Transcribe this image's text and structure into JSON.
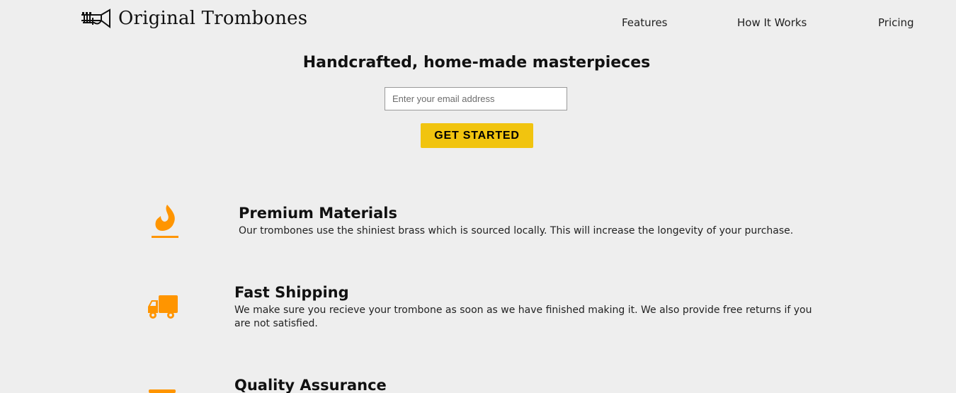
{
  "brand": {
    "name": "Original Trombones",
    "icon": "trombone-icon"
  },
  "nav": {
    "items": [
      {
        "label": "Features"
      },
      {
        "label": "How It Works"
      },
      {
        "label": "Pricing"
      }
    ]
  },
  "hero": {
    "title": "Handcrafted, home-made masterpieces",
    "email_placeholder": "Enter your email address",
    "email_value": "",
    "cta_label": "GET STARTED"
  },
  "features": [
    {
      "icon": "fire-icon",
      "title": "Premium Materials",
      "text": "Our trombones use the shiniest brass which is sourced locally. This will increase the longevity of your purchase."
    },
    {
      "icon": "truck-icon",
      "title": "Fast Shipping",
      "text": "We make sure you recieve your trombone as soon as we have finished making it. We also provide free returns if you are not satisfied."
    },
    {
      "icon": "battery-icon",
      "title": "Quality Assurance",
      "text": ""
    }
  ],
  "colors": {
    "background": "#eeeeee",
    "accent": "#f1c40f",
    "icon": "#ff9500"
  }
}
